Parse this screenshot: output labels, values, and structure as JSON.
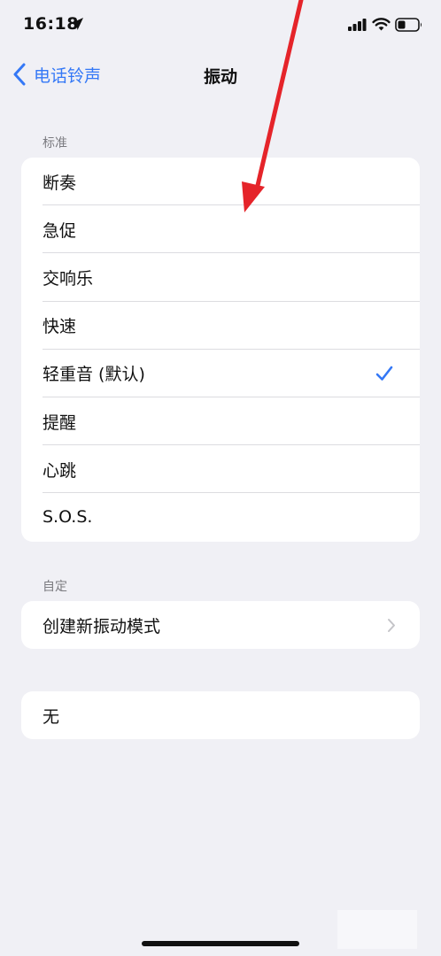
{
  "status_bar": {
    "time": "16:18"
  },
  "nav": {
    "back_label": "电话铃声",
    "title": "振动"
  },
  "standard": {
    "header": "标准",
    "items": [
      "断奏",
      "急促",
      "交响乐",
      "快速",
      "轻重音 (默认)",
      "提醒",
      "心跳",
      "S.O.S."
    ],
    "selected": "轻重音 (默认)"
  },
  "custom": {
    "header": "自定",
    "create_label": "创建新振动模式"
  },
  "none_label": "无",
  "colors": {
    "accent": "#3478f6",
    "background": "#f0f0f5",
    "annotation": "#e5242a"
  }
}
